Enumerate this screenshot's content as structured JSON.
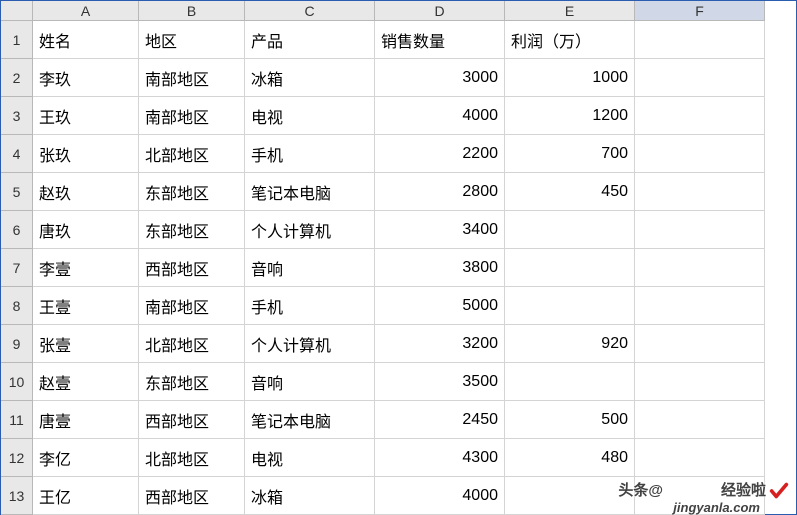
{
  "columns": [
    "A",
    "B",
    "C",
    "D",
    "E",
    "F"
  ],
  "selectedColumn": "F",
  "headers": {
    "A": "姓名",
    "B": "地区",
    "C": "产品",
    "D": "销售数量",
    "E": "利润（万）"
  },
  "rows": [
    {
      "num": 1,
      "A": "姓名",
      "B": "地区",
      "C": "产品",
      "D": "销售数量",
      "E": "利润（万）",
      "F": ""
    },
    {
      "num": 2,
      "A": "李玖",
      "B": "南部地区",
      "C": "冰箱",
      "D": 3000,
      "E": 1000,
      "F": ""
    },
    {
      "num": 3,
      "A": "王玖",
      "B": "南部地区",
      "C": "电视",
      "D": 4000,
      "E": 1200,
      "F": ""
    },
    {
      "num": 4,
      "A": "张玖",
      "B": "北部地区",
      "C": "手机",
      "D": 2200,
      "E": 700,
      "F": ""
    },
    {
      "num": 5,
      "A": "赵玖",
      "B": "东部地区",
      "C": "笔记本电脑",
      "D": 2800,
      "E": 450,
      "F": ""
    },
    {
      "num": 6,
      "A": "唐玖",
      "B": "东部地区",
      "C": "个人计算机",
      "D": 3400,
      "E": "",
      "F": ""
    },
    {
      "num": 7,
      "A": "李壹",
      "B": "西部地区",
      "C": "音响",
      "D": 3800,
      "E": "",
      "F": ""
    },
    {
      "num": 8,
      "A": "王壹",
      "B": "南部地区",
      "C": "手机",
      "D": 5000,
      "E": "",
      "F": ""
    },
    {
      "num": 9,
      "A": "张壹",
      "B": "北部地区",
      "C": "个人计算机",
      "D": 3200,
      "E": 920,
      "F": ""
    },
    {
      "num": 10,
      "A": "赵壹",
      "B": "东部地区",
      "C": "音响",
      "D": 3500,
      "E": "",
      "F": ""
    },
    {
      "num": 11,
      "A": "唐壹",
      "B": "西部地区",
      "C": "笔记本电脑",
      "D": 2450,
      "E": 500,
      "F": ""
    },
    {
      "num": 12,
      "A": "李亿",
      "B": "北部地区",
      "C": "电视",
      "D": 4300,
      "E": 480,
      "F": ""
    },
    {
      "num": 13,
      "A": "王亿",
      "B": "西部地区",
      "C": "冰箱",
      "D": 4000,
      "E": "",
      "F": ""
    }
  ],
  "watermark": {
    "main_prefix": "头条@",
    "main_suffix": "经验啦",
    "sub": "jingyanla.com"
  }
}
